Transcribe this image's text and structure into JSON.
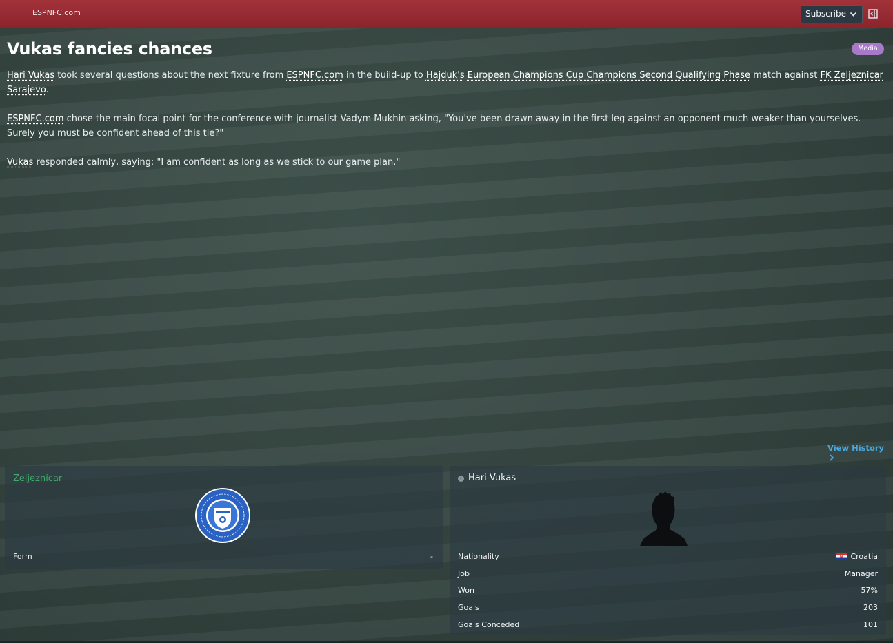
{
  "topbar": {
    "site_name": "ESPNFC.com",
    "subscribe_label": "Subscribe",
    "icons": [
      "chevron-down-icon",
      "collapse-panel-icon"
    ]
  },
  "article": {
    "headline": "Vukas fancies chances",
    "badge": "Media",
    "p1": {
      "link_manager": "Hari Vukas",
      "t1": " took several questions about the next fixture from ",
      "link_source": "ESPNFC.com",
      "t2": " in the build-up to ",
      "link_club": "Hajduk's",
      "t3": " ",
      "link_competition": "European Champions Cup Champions Second Qualifying Phase",
      "t4": " match against ",
      "link_opponent": "FK Zeljeznicar Sarajevo",
      "t5": "."
    },
    "p2": {
      "link_source": "ESPNFC.com",
      "t1": " chose the main focal point for the conference with journalist Vadym Mukhin asking, \"You've been drawn away in the first leg against an opponent much weaker than yourselves. Surely you must be confident ahead of this tie?\""
    },
    "p3": {
      "link_manager": "Vukas",
      "t1": " responded calmly, saying: \"I am confident as long as we stick to our game plan.\""
    }
  },
  "view_history_label": "View History",
  "club_panel": {
    "title": "Zeljeznicar",
    "crest_icon": "club-crest-icon",
    "rows": [
      {
        "label": "Form",
        "value": "-"
      }
    ]
  },
  "manager_panel": {
    "title": "Hari Vukas",
    "silhouette_icon": "person-silhouette-icon",
    "nationality_label": "Nationality",
    "nationality_value": "Croatia",
    "rows": [
      {
        "label": "Job",
        "value": "Manager"
      },
      {
        "label": "Won",
        "value": "57%"
      },
      {
        "label": "Goals",
        "value": "203"
      },
      {
        "label": "Goals Conceded",
        "value": "101"
      }
    ]
  },
  "colors": {
    "topbar": "#8c242c",
    "badge": "#a879c6",
    "link_accent": "#4aa8e0",
    "club_title": "#3fa86a"
  }
}
